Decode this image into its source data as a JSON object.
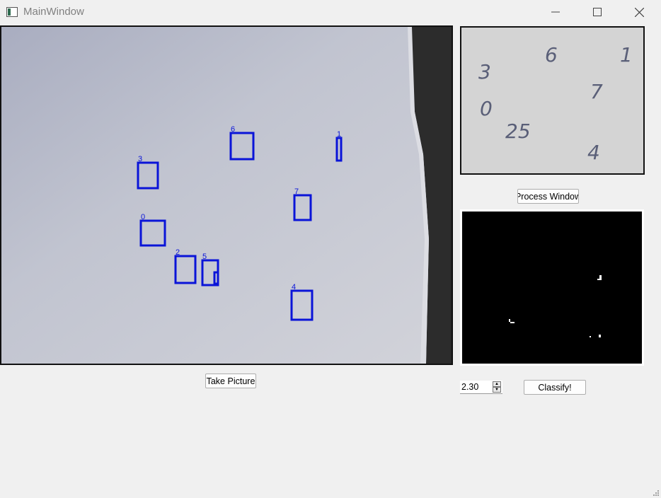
{
  "window": {
    "title": "MainWindow"
  },
  "controls": {
    "take_picture": "Take Picture",
    "process_window": "Process Window",
    "classify": "Classify!",
    "threshold_value": "2.30"
  },
  "detections": [
    "3",
    "6",
    "1",
    "7",
    "0",
    "2",
    "5",
    "4"
  ],
  "cropped_preview": {
    "digits": [
      "3",
      "6",
      "1",
      "7",
      "0",
      "25",
      "4"
    ]
  },
  "colors": {
    "box": "#0a14d8",
    "window_bg": "#f0f0f0"
  },
  "icons": [
    "app-icon",
    "minimize-icon",
    "maximize-icon",
    "close-icon",
    "spin-up-icon",
    "spin-down-icon",
    "resize-grip-icon"
  ]
}
